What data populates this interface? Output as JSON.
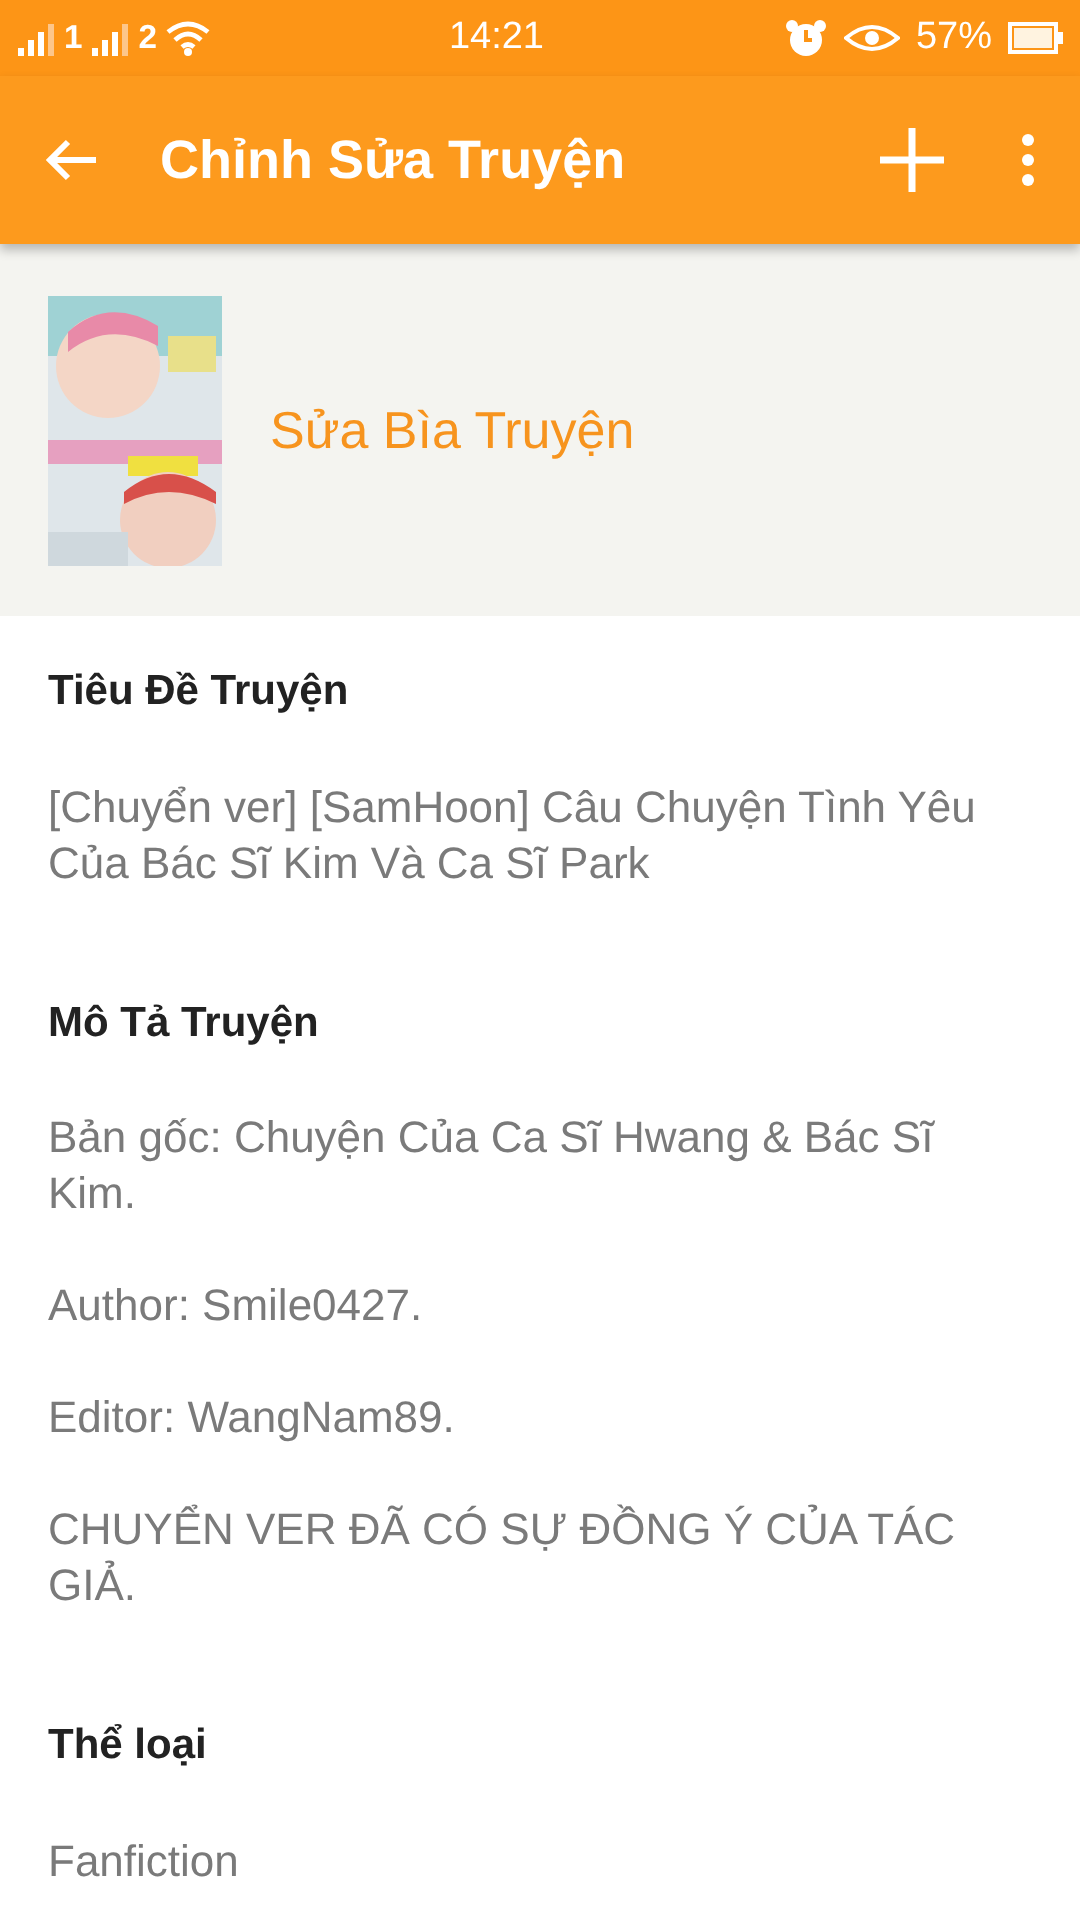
{
  "status_bar": {
    "sim_1": "1",
    "sim_2": "2",
    "time": "14:21",
    "battery": "57%"
  },
  "app_bar": {
    "title": "Chỉnh Sửa Truyện"
  },
  "cover": {
    "kind": "picture",
    "action": "Sửa Bìa Truyện"
  },
  "fields": [
    {
      "label": "Tiêu Đề Truyện",
      "paragraphs": [
        "[Chuyển ver] [SamHoon] Câu Chuyện Tình Yêu Của Bác Sĩ Kim Và Ca Sĩ Park"
      ]
    },
    {
      "label": "Mô Tả Truyện",
      "paragraphs": [
        "Bản gốc: Chuyện Của Ca Sĩ Hwang & Bác Sĩ Kim.",
        "Author: Smile0427.",
        "Editor: WangNam89.",
        "CHUYỂN VER ĐÃ CÓ SỰ ĐỒNG Ý CỦA TÁC GIẢ."
      ]
    },
    {
      "label": "Thể loại",
      "paragraphs": [
        "Fanfiction"
      ]
    }
  ]
}
